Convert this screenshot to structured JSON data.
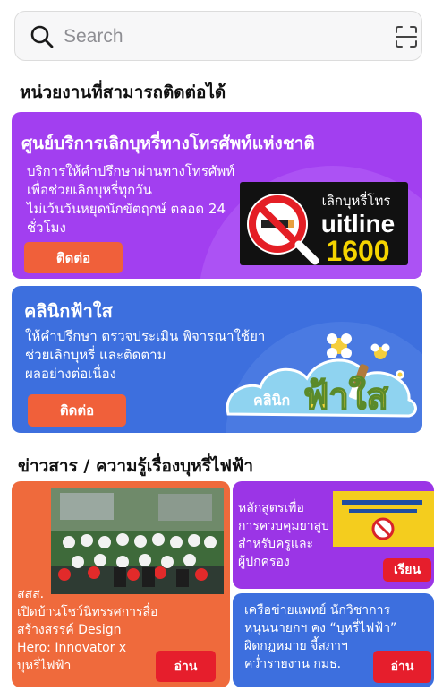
{
  "search": {
    "placeholder": "Search",
    "icon": "search-icon",
    "scan_icon": "scan-icon"
  },
  "sections": {
    "agencies_title": "หน่วยงานที่สามารถติดต่อได้",
    "news_title": "ข่าวสาร / ความรู้เรื่องบุหรี่ไฟฟ้า"
  },
  "agencies": [
    {
      "title": "ศูนย์บริการเลิกบุหรี่ทางโทรศัพท์แห่งชาติ",
      "description": [
        "บริการให้คำปรึกษาผ่านทางโทรศัพท์",
        "เพื่อช่วยเลิกบุหรี่ทุกวัน",
        "ไม่เว้นวันหยุดนักขัตฤกษ์ ตลอด 24",
        "ชั่วโมง"
      ],
      "button": "ติดต่อ",
      "logo": {
        "top_text": "เลิกบุหรี่โทร",
        "word": "uitline",
        "number": "1600"
      }
    },
    {
      "title": "คลินิกฟ้าใส",
      "description": [
        "ให้คำปรึกษา ตรวจประเมิน พิจารณาใช้ยา",
        "ช่วยเลิกบุหรี่ และติดตาม",
        "ผลอย่างต่อเนื่อง"
      ],
      "button": "ติดต่อ",
      "logo": {
        "small": "คลินิก",
        "big": "ฟ้าใส"
      }
    }
  ],
  "news": [
    {
      "text": [
        "สสส.",
        "เปิดบ้านโชว์นิทรรศการสื่อ",
        "สร้างสรรค์ Design",
        "Hero: Innovator x",
        "บุหรี่ไฟฟ้า"
      ],
      "button": "อ่าน"
    },
    {
      "text": [
        "หลักสูตรเพื่อ",
        "การควบคุมยาสูบ",
        "สำหรับครูและ",
        "ผู้ปกครอง"
      ],
      "button": "เรียน"
    },
    {
      "text": [
        "เครือข่ายแพทย์ นักวิชาการ",
        "หนุนนายกฯ คง “บุหรี่ไฟฟ้า”",
        "ผิดกฎหมาย จี้สภาฯ",
        "คว่ำรายงาน กมธ."
      ],
      "button": "อ่าน"
    }
  ],
  "colors": {
    "purple_card": "#a23ff0",
    "blue_card": "#3d6fde",
    "orange_button": "#f0603a",
    "red_button": "#e61e2c",
    "news_orange": "#ef6a3c"
  }
}
